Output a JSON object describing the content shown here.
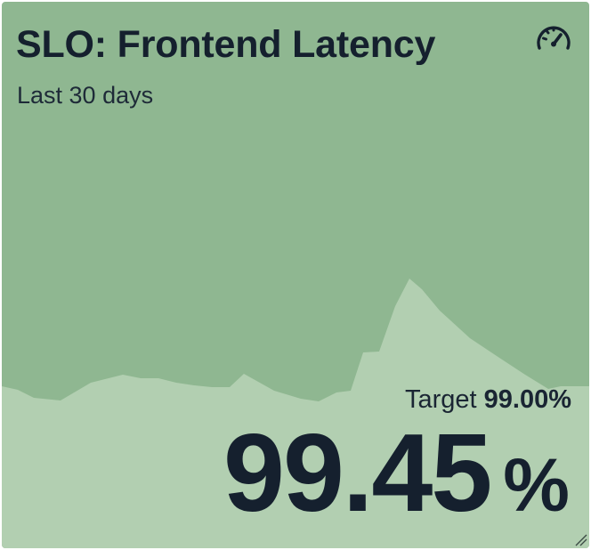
{
  "panel": {
    "title": "SLO: Frontend Latency",
    "subtitle": "Last 30 days",
    "target_label": "Target",
    "target_value": "99.00%",
    "metric_value": "99.45",
    "metric_unit": "%",
    "header_icon": "gauge-icon",
    "resize_icon": "resize-handle-icon"
  },
  "colors": {
    "background": "#8fb791",
    "trend_fill": "#b2cfb1",
    "text": "#15202e"
  }
}
